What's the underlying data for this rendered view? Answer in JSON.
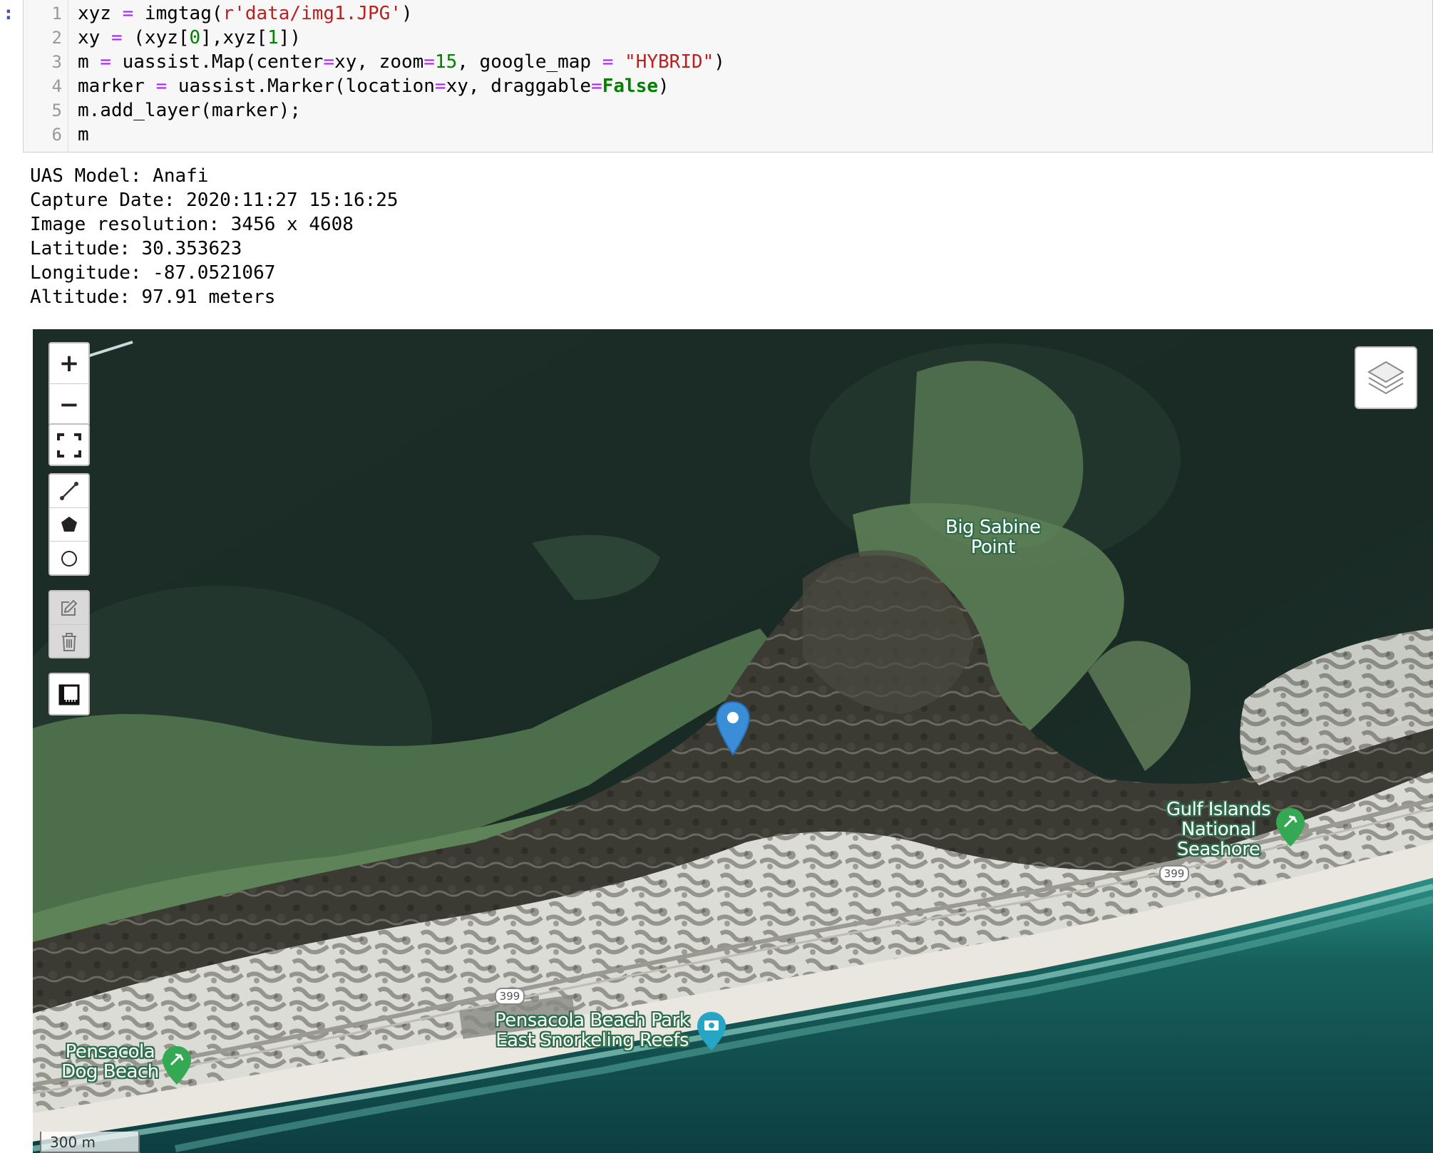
{
  "notebook": {
    "prompt_marker": ":",
    "code_lines": [
      {
        "n": "1",
        "parts": [
          [
            "",
            "xyz "
          ],
          [
            "op",
            "="
          ],
          [
            "",
            " imgtag("
          ],
          [
            "str",
            "r'data/img1.JPG'"
          ],
          [
            "",
            ")"
          ]
        ]
      },
      {
        "n": "2",
        "parts": [
          [
            "",
            "xy "
          ],
          [
            "op",
            "="
          ],
          [
            "",
            " (xyz["
          ],
          [
            "num",
            "0"
          ],
          [
            "",
            "],xyz["
          ],
          [
            "num",
            "1"
          ],
          [
            "",
            "])"
          ]
        ]
      },
      {
        "n": "3",
        "parts": [
          [
            "",
            "m "
          ],
          [
            "op",
            "="
          ],
          [
            "",
            " uassist.Map(center"
          ],
          [
            "op",
            "="
          ],
          [
            "",
            "xy, zoom"
          ],
          [
            "op",
            "="
          ],
          [
            "num",
            "15"
          ],
          [
            "",
            ", google_map "
          ],
          [
            "op",
            "="
          ],
          [
            "",
            " "
          ],
          [
            "str",
            "\"HYBRID\""
          ],
          [
            "",
            ")"
          ]
        ]
      },
      {
        "n": "4",
        "parts": [
          [
            "",
            "marker "
          ],
          [
            "op",
            "="
          ],
          [
            "",
            " uassist.Marker(location"
          ],
          [
            "op",
            "="
          ],
          [
            "",
            "xy, draggable"
          ],
          [
            "op",
            "="
          ],
          [
            "kw",
            "False"
          ],
          [
            "",
            ")"
          ]
        ]
      },
      {
        "n": "5",
        "parts": [
          [
            "",
            "m.add_layer(marker);"
          ]
        ]
      },
      {
        "n": "6",
        "parts": [
          [
            "",
            "m"
          ]
        ]
      }
    ],
    "output_lines": [
      "UAS Model: Anafi",
      "Capture Date: 2020:11:27 15:16:25",
      "Image resolution: 3456 x 4608",
      "Latitude: 30.353623",
      "Longitude: -87.0521067",
      "Altitude: 97.91 meters"
    ]
  },
  "map": {
    "controls": {
      "zoom_in": "+",
      "zoom_out": "−"
    },
    "icons": [
      "fullscreen-icon",
      "draw-polyline-icon",
      "draw-polygon-icon",
      "draw-circle-icon",
      "edit-layers-icon",
      "delete-layers-icon",
      "measure-icon",
      "layers-icon",
      "map-marker-icon"
    ],
    "labels": {
      "big_sabine": [
        "Big Sabine",
        "Point"
      ],
      "gulf_islands": [
        "Gulf Islands",
        "National",
        "Seashore"
      ],
      "pensacola_park": [
        "Pensacola Beach Park",
        "East Snorkeling Reefs"
      ],
      "pensacola_dog": [
        "Pensacola",
        "Dog Beach"
      ]
    },
    "road_shields": [
      "399",
      "399"
    ],
    "scale": "300 m",
    "colors": {
      "marker": "#3a8ed8",
      "park_pin": "#34a853",
      "photo_pin": "#26a5c4"
    }
  }
}
